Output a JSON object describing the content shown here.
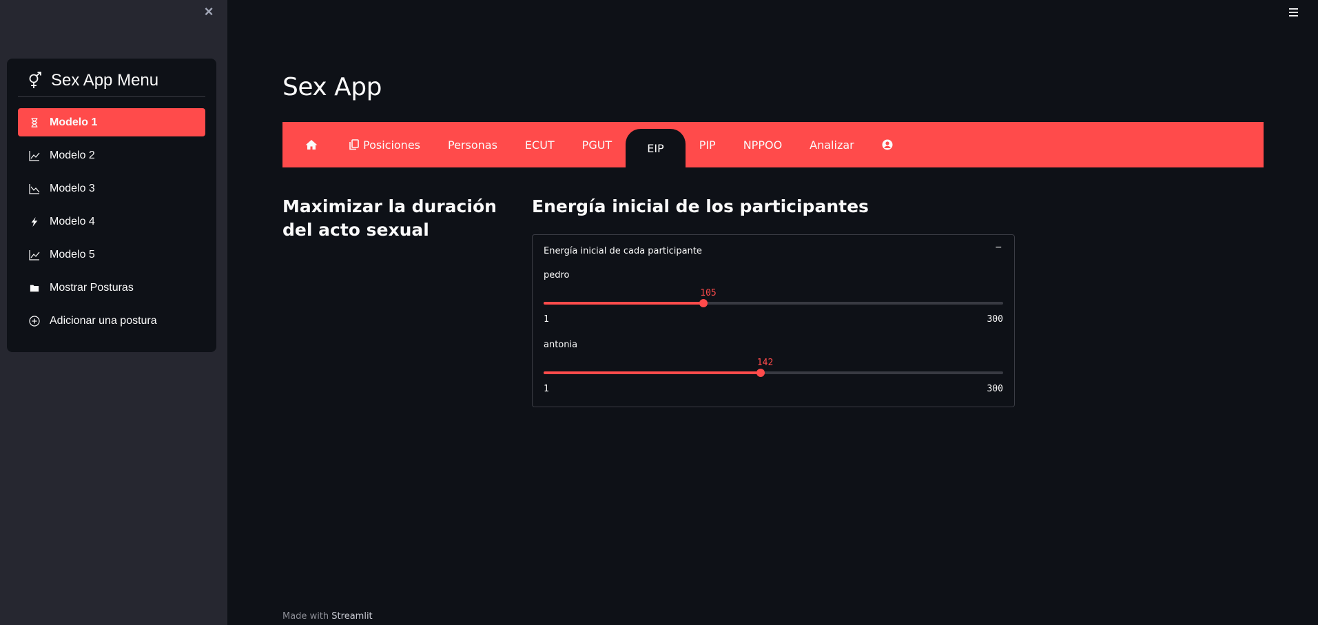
{
  "sidebar": {
    "menu_title": "Sex App Menu",
    "items": [
      {
        "label": "Modelo 1",
        "icon": "hourglass-icon"
      },
      {
        "label": "Modelo 2",
        "icon": "graph-up-icon"
      },
      {
        "label": "Modelo 3",
        "icon": "graph-down-icon"
      },
      {
        "label": "Modelo 4",
        "icon": "lightning-icon"
      },
      {
        "label": "Modelo 5",
        "icon": "graph-up-icon"
      },
      {
        "label": "Mostrar Posturas",
        "icon": "folder-icon"
      },
      {
        "label": "Adicionar una postura",
        "icon": "plus-circle-icon"
      }
    ],
    "active_index": 0
  },
  "main": {
    "title": "Sex App",
    "nav": [
      {
        "label": "",
        "icon": "home-icon"
      },
      {
        "label": "Posiciones",
        "icon": "copy-icon"
      },
      {
        "label": "Personas"
      },
      {
        "label": "ECUT"
      },
      {
        "label": "PGUT"
      },
      {
        "label": "EIP"
      },
      {
        "label": "PIP"
      },
      {
        "label": "NPPOO"
      },
      {
        "label": "Analizar"
      },
      {
        "label": "",
        "icon": "user-circle-icon"
      }
    ],
    "active_nav": 5,
    "left_heading": "Maximizar la duración del acto sexual",
    "right_heading": "Energía inicial de los participantes",
    "expander": {
      "header": "Energía inicial de cada participante",
      "toggle": "−",
      "sliders": [
        {
          "label": "pedro",
          "value": 105,
          "min": 1,
          "max": 300,
          "min_label": "1",
          "max_label": "300",
          "value_label": "105"
        },
        {
          "label": "antonia",
          "value": 142,
          "min": 1,
          "max": 300,
          "min_label": "1",
          "max_label": "300",
          "value_label": "142"
        }
      ]
    }
  },
  "footer": {
    "prefix": "Made with",
    "brand": "Streamlit"
  },
  "colors": {
    "accent": "#ff4b4b",
    "background": "#0e1117",
    "sidebar": "#262730"
  }
}
